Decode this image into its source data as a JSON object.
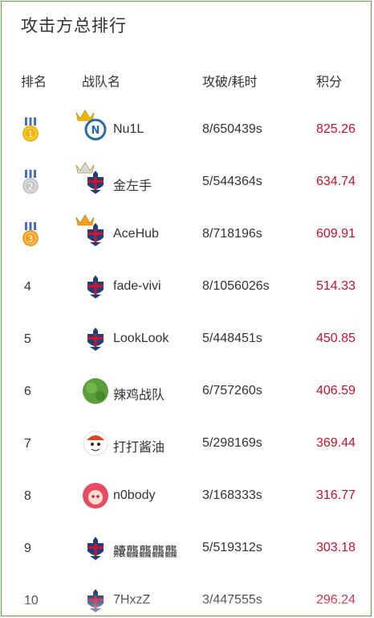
{
  "title": "攻击方总排行",
  "headers": {
    "rank": "排名",
    "team": "战队名",
    "attack": "攻破/耗时",
    "score": "积分"
  },
  "colors": {
    "score": "#c8102e",
    "border": "#5aa83c",
    "gold": "#f5b400",
    "silver": "#c8c8c8",
    "bronze": "#f0a020"
  },
  "rows": [
    {
      "rank": "1",
      "medal": "gold-medal-icon",
      "crown": "gold-crown-icon",
      "avatar": "nu1l-logo-icon",
      "team": "Nu1L",
      "attack": "8/650439s",
      "score": "825.26"
    },
    {
      "rank": "2",
      "medal": "silver-medal-icon",
      "crown": "silver-crown-icon",
      "avatar": "team-badge-icon",
      "team": "金左手",
      "attack": "5/544364s",
      "score": "634.74"
    },
    {
      "rank": "3",
      "medal": "bronze-medal-icon",
      "crown": "bronze-crown-icon",
      "avatar": "team-badge-icon",
      "team": "AceHub",
      "attack": "8/718196s",
      "score": "609.91"
    },
    {
      "rank": "4",
      "avatar": "team-badge-icon",
      "team": "fade-vivi",
      "attack": "8/1056026s",
      "score": "514.33"
    },
    {
      "rank": "5",
      "avatar": "team-badge-icon",
      "team": "LookLook",
      "attack": "5/448451s",
      "score": "450.85"
    },
    {
      "rank": "6",
      "avatar": "green-circle-avatar",
      "team": "辣鸡战队",
      "attack": "6/757260s",
      "score": "406.59"
    },
    {
      "rank": "7",
      "avatar": "cartoon-avatar",
      "team": "打打酱油",
      "attack": "5/298169s",
      "score": "369.44"
    },
    {
      "rank": "8",
      "avatar": "anime-avatar",
      "team": "n0body",
      "attack": "3/168333s",
      "score": "316.77"
    },
    {
      "rank": "9",
      "avatar": "team-badge-icon",
      "team": "齉龘龘龘龘",
      "attack": "5/519312s",
      "score": "303.18"
    },
    {
      "rank": "10",
      "avatar": "team-badge-icon",
      "team": "7HxzZ",
      "attack": "3/447555s",
      "score": "296.24"
    }
  ]
}
